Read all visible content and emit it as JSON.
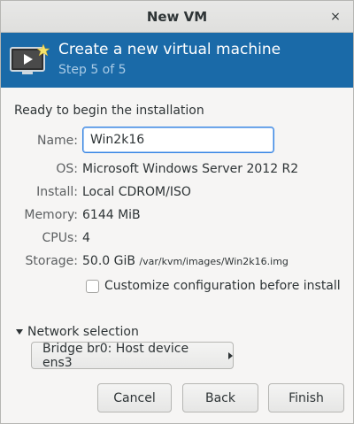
{
  "window": {
    "title": "New VM",
    "close_glyph": "×"
  },
  "banner": {
    "heading": "Create a new virtual machine",
    "step": "Step 5 of 5",
    "icon": "monitor-play-icon"
  },
  "content": {
    "ready_text": "Ready to begin the installation",
    "name_label": "Name:",
    "name_value": "Win2k16",
    "os_label": "OS:",
    "os_value": "Microsoft Windows Server 2012 R2",
    "install_label": "Install:",
    "install_value": "Local CDROM/ISO",
    "memory_label": "Memory:",
    "memory_value": "6144 MiB",
    "cpus_label": "CPUs:",
    "cpus_value": "4",
    "storage_label": "Storage:",
    "storage_size": "50.0 GiB",
    "storage_path": "/var/kvm/images/Win2k16.img",
    "customize_label": "Customize configuration before install",
    "customize_checked": false
  },
  "network": {
    "expander_label": "Network selection",
    "selection": "Bridge br0: Host device ens3"
  },
  "buttons": {
    "cancel": "Cancel",
    "back": "Back",
    "finish": "Finish"
  },
  "colors": {
    "banner_bg": "#1a6aa8",
    "banner_step": "#a9cbe6",
    "focus_border": "#3584e4"
  }
}
